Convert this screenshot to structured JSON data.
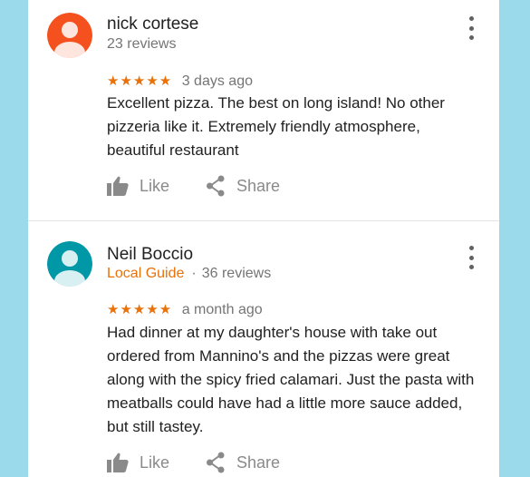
{
  "reviews": [
    {
      "author": "nick cortese",
      "reviews_count": "23 reviews",
      "local_guide": "",
      "stars": "★★★★★",
      "rating": 5,
      "time": "3 days ago",
      "text": "Excellent pizza. The best on long island! No other pizzeria like it. Extremely friendly atmosphere, beautiful restaurant",
      "avatar_color": "#f4511e",
      "like_label": "Like",
      "share_label": "Share"
    },
    {
      "author": "Neil Boccio",
      "reviews_count": "36 reviews",
      "local_guide": "Local Guide",
      "separator": "·",
      "stars": "★★★★★",
      "rating": 5,
      "time": "a month ago",
      "text": "Had dinner at my daughter's house with take out ordered from Mannino's and the pizzas were great along with the spicy fried calamari. Just the pasta with meatballs could have had a little more sauce added, but still tastey.",
      "avatar_color": "#0097a7",
      "like_label": "Like",
      "share_label": "Share"
    }
  ],
  "colors": {
    "background": "#9bdaea",
    "card": "#ffffff",
    "stars": "#e8710a",
    "local_guide": "#e8710a"
  },
  "icons": [
    "more-vert-icon",
    "thumb-up-icon",
    "share-icon",
    "avatar-person-icon"
  ]
}
